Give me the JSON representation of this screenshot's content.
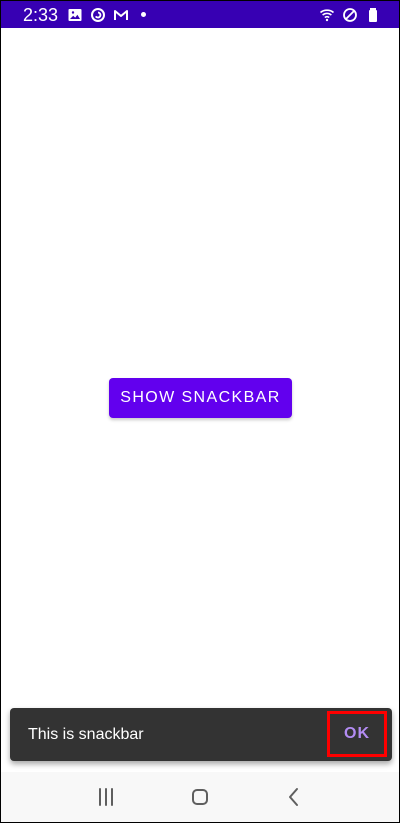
{
  "status_bar": {
    "time": "2:33",
    "left_icons": [
      "image-icon",
      "sync-icon",
      "gmail-icon",
      "notification-dot"
    ],
    "right_icons": [
      "wifi-icon",
      "do-not-disturb-icon",
      "battery-icon"
    ],
    "background": "#3700b3"
  },
  "main": {
    "primary_action_label": "SHOW SNACKBAR",
    "primary_button_color": "#6200ee"
  },
  "snackbar": {
    "message": "This is snackbar",
    "action_label": "OK",
    "background": "#333333",
    "action_color": "#b38cf3",
    "highlight_color": "#ff0000"
  },
  "navigation_bar": {
    "buttons": [
      "recent-apps-icon",
      "home-icon",
      "back-icon"
    ],
    "background": "#f8f8f8"
  }
}
